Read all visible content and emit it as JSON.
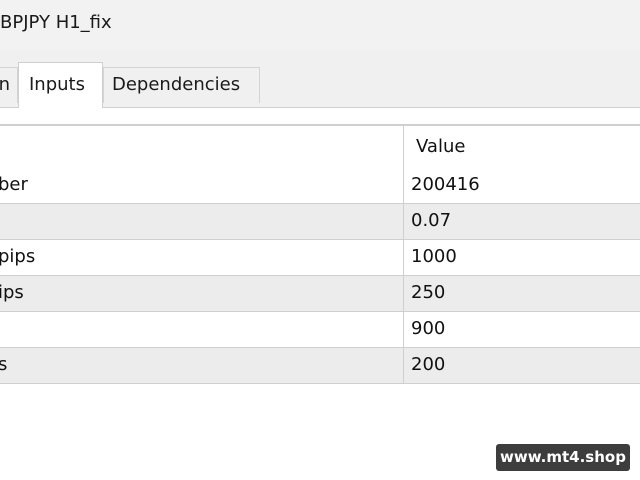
{
  "window": {
    "title": "BPJPY H1_fix"
  },
  "tabs": [
    {
      "label": "n",
      "active": false
    },
    {
      "label": "Inputs",
      "active": true
    },
    {
      "label": "Dependencies",
      "active": false
    }
  ],
  "table": {
    "columns": [
      "",
      "Value"
    ],
    "rows": [
      {
        "variable": "ber",
        "value": "200416"
      },
      {
        "variable": "",
        "value": "0.07"
      },
      {
        "variable": "pips",
        "value": "1000"
      },
      {
        "variable": "ips",
        "value": "250"
      },
      {
        "variable": "",
        "value": "900"
      },
      {
        "variable": "s",
        "value": "200"
      }
    ]
  },
  "watermark": {
    "text": "www.mt4.shop"
  },
  "colors": {
    "titlebar_bg": "#f2f2f2",
    "tabstrip_bg": "#f0f0f0",
    "row_alt_bg": "#ececec",
    "grid_line": "#cfcfcf",
    "watermark_bg": "#3d3d3d"
  }
}
